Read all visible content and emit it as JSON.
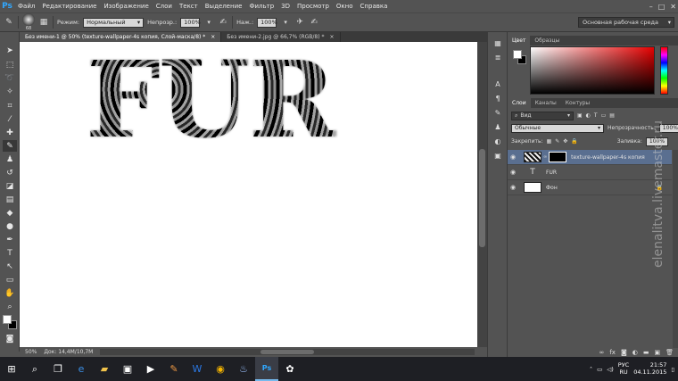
{
  "app": {
    "logo": "Ps",
    "menu": [
      "Файл",
      "Редактирование",
      "Изображение",
      "Слои",
      "Текст",
      "Выделение",
      "Фильтр",
      "3D",
      "Просмотр",
      "Окно",
      "Справка"
    ]
  },
  "options": {
    "brush_size": "68",
    "mode_label": "Режим:",
    "mode_value": "Нормальный",
    "opacity_label": "Непрозр.:",
    "opacity_value": "100%",
    "pressure_label": "Наж.:",
    "pressure_value": "100%",
    "workspace": "Основная рабочая среда"
  },
  "documents": {
    "tabs": [
      {
        "label": "Без имени-1 @ 50% (texture-wallpaper-4s копия, Слой-маска/8) *",
        "active": true
      },
      {
        "label": "Без имени-2.jpg @ 66,7% (RGB/8) *",
        "active": false
      }
    ]
  },
  "canvas": {
    "text": "FUR"
  },
  "status": {
    "zoom": "50%",
    "doc_info": "Док: 14,4M/10,7M"
  },
  "panels": {
    "color_tabs": [
      "Цвет",
      "Образцы"
    ],
    "layers_tabs": [
      "Слои",
      "Каналы",
      "Контуры"
    ],
    "filter_kind": "Вид",
    "blend_mode": "Обычные",
    "opacity_label": "Непрозрачность:",
    "opacity_value": "100%",
    "lock_label": "Закрепить:",
    "fill_label": "Заливка:",
    "fill_value": "100%",
    "layers": [
      {
        "name": "texture-wallpaper-4s копия",
        "selected": true,
        "kind": "masked"
      },
      {
        "name": "FUR",
        "selected": false,
        "kind": "text"
      },
      {
        "name": "Фон",
        "selected": false,
        "kind": "background"
      }
    ]
  },
  "taskbar": {
    "lang_top": "РУС",
    "lang_bottom": "RU",
    "time": "21:57",
    "date": "04.11.2015"
  },
  "watermark": "elenalitva.livemaster.ru"
}
